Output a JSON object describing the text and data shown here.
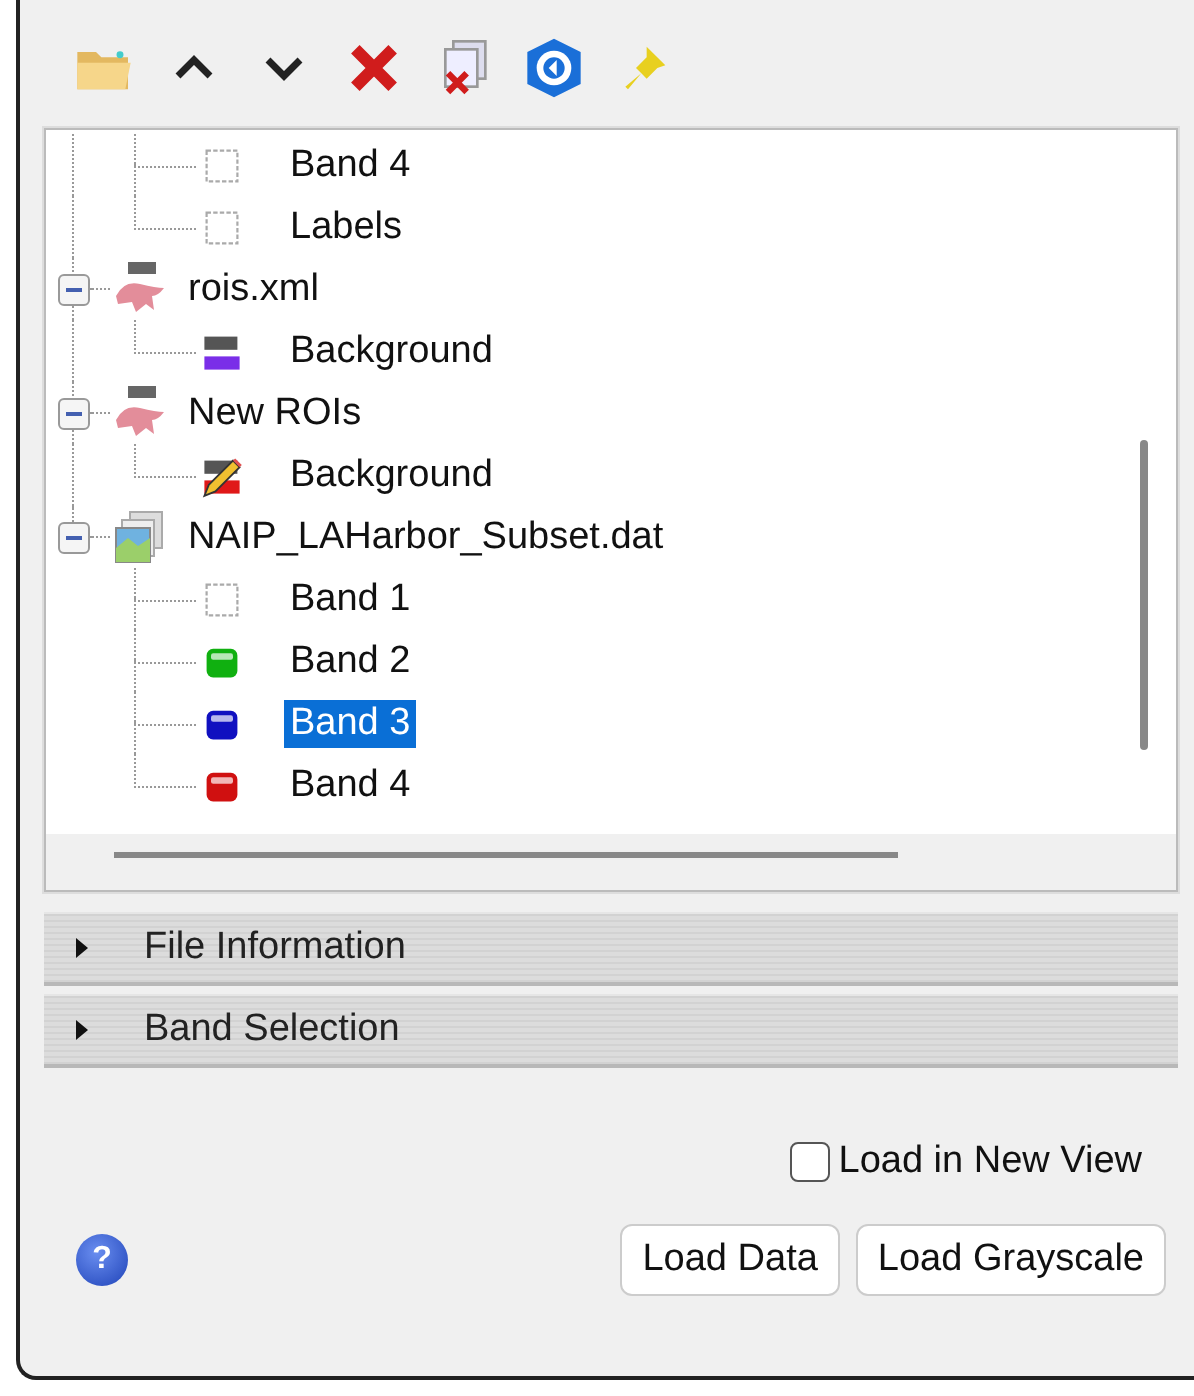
{
  "toolbar": [
    {
      "kind": "open"
    },
    {
      "kind": "up"
    },
    {
      "kind": "down"
    },
    {
      "kind": "remove"
    },
    {
      "kind": "remove-all"
    },
    {
      "kind": "refresh"
    },
    {
      "kind": "pin"
    }
  ],
  "tree": [
    {
      "children": [
        {
          "kind": "checkbox",
          "label": "Band 4",
          "selected": false
        },
        {
          "kind": "checkbox",
          "label": "Labels",
          "selected": false
        }
      ]
    },
    {
      "kind": "roi-file",
      "label": "rois.xml",
      "expanded": true,
      "children": [
        {
          "kind": "roi",
          "label": "Background",
          "color": "#7a2ee8",
          "editing": false,
          "selected": false
        }
      ]
    },
    {
      "kind": "roi-file",
      "label": "New ROIs",
      "expanded": true,
      "children": [
        {
          "kind": "roi",
          "label": "Background",
          "color": "#e01818",
          "editing": true,
          "selected": false
        }
      ]
    },
    {
      "kind": "raster",
      "label": "NAIP_LAHarbor_Subset.dat",
      "expanded": true,
      "children": [
        {
          "kind": "checkbox",
          "label": "Band 1",
          "selected": false
        },
        {
          "kind": "band",
          "label": "Band 2",
          "color": "#10b010",
          "selected": false
        },
        {
          "kind": "band",
          "label": "Band 3",
          "color": "#1010c0",
          "selected": true
        },
        {
          "kind": "band",
          "label": "Band 4",
          "color": "#d01010",
          "selected": false
        }
      ]
    }
  ],
  "sections": [
    {
      "label": "File Information",
      "expanded": false
    },
    {
      "label": "Band Selection",
      "expanded": false
    }
  ],
  "load_in_new_view": {
    "label": "Load in New View",
    "checked": false
  },
  "help": "?",
  "buttons": [
    "Load Data",
    "Load Grayscale"
  ]
}
